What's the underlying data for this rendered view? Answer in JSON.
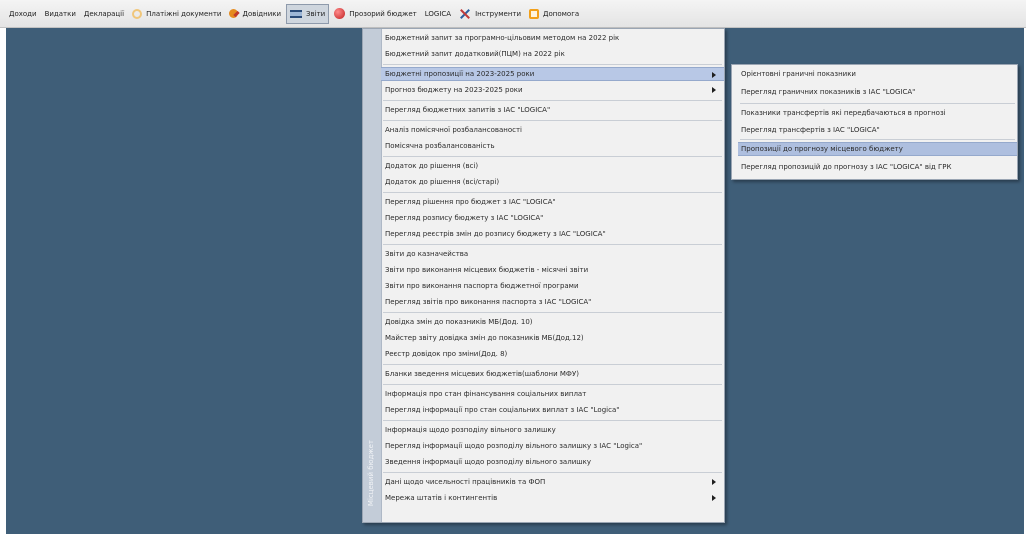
{
  "menubar": {
    "items": [
      {
        "label": "Доходи"
      },
      {
        "label": "Видатки"
      },
      {
        "label": "Декларації"
      },
      {
        "label": "Платіжні документи"
      },
      {
        "label": "Довідники"
      },
      {
        "label": "Звіти"
      },
      {
        "label": "Прозорий бюджет"
      },
      {
        "label": "LOGICA"
      },
      {
        "label": "Інструменти"
      },
      {
        "label": "Допомога"
      }
    ]
  },
  "main_menu": {
    "side_strip_label": "Місцевий бюджет",
    "items": [
      {
        "label": "Бюджетний запит за програмно-цільовим методом на 2022 рік"
      },
      {
        "label": "Бюджетний запит додатковий(ПЦМ) на 2022 рік"
      },
      {
        "label": "Бюджетні пропозиції на 2023-2025 роки"
      },
      {
        "label": "Прогноз бюджету на 2023-2025 роки"
      },
      {
        "label": "Перегляд бюджетних запитів з ІАС \"LOGICA\""
      },
      {
        "label": "Аналіз помісячної розбалансованості"
      },
      {
        "label": "Помісячна розбалансованість"
      },
      {
        "label": "Додаток до рішення (всі)"
      },
      {
        "label": "Додаток до рішення (всі/старі)"
      },
      {
        "label": "Перегляд рішення про бюджет з ІАС \"LOGICA\""
      },
      {
        "label": "Перегляд розпису бюджету з ІАС \"LOGICA\""
      },
      {
        "label": "Перегляд реєстрів змін до розпису бюджету з ІАС \"LOGICA\""
      },
      {
        "label": "Звіти до казначейства"
      },
      {
        "label": "Звіти про виконання місцевих бюджетів - місячні звіти"
      },
      {
        "label": "Звіти про виконання паспорта бюджетної програми"
      },
      {
        "label": "Перегляд звітів про виконання паспорта з ІАС \"LOGICA\""
      },
      {
        "label": "Довідка змін до показників МБ(Дод. 10)"
      },
      {
        "label": "Майстер звіту довідка змін до показників МБ(Дод.12)"
      },
      {
        "label": "Реєстр довідок про зміни(Дод. 8)"
      },
      {
        "label": "Бланки зведення місцевих бюджетів(шаблони МФУ)"
      },
      {
        "label": "Інформація про стан фінансування соціальних виплат"
      },
      {
        "label": "Перегляд інформації про стан соціальних виплат з ІАС \"Logica\""
      },
      {
        "label": "Інформація щодо розподілу вільного залишку"
      },
      {
        "label": "Перегляд інформації щодо розподілу вільного залишку з ІАС \"Logica\""
      },
      {
        "label": "Зведення інформації щодо розподілу вільного залишку"
      },
      {
        "label": "Дані щодо чисельності працівників та ФОП"
      },
      {
        "label": "Мережа штатів і контингентів"
      }
    ]
  },
  "submenu": {
    "items": [
      {
        "label": "Орієнтовні граничні показники"
      },
      {
        "label": "Перегляд граничних показників з ІАС \"LOGICA\""
      },
      {
        "label": "Показники трансфертів які передбачаються в прогнозі"
      },
      {
        "label": "Перегляд трансфертів з ІАС \"LOGICA\""
      },
      {
        "label": "Пропозиції до прогнозу місцевого бюджету"
      },
      {
        "label": "Перегляд пропозицій до прогнозу з ІАС \"LOGICA\" від ГРК"
      }
    ]
  }
}
